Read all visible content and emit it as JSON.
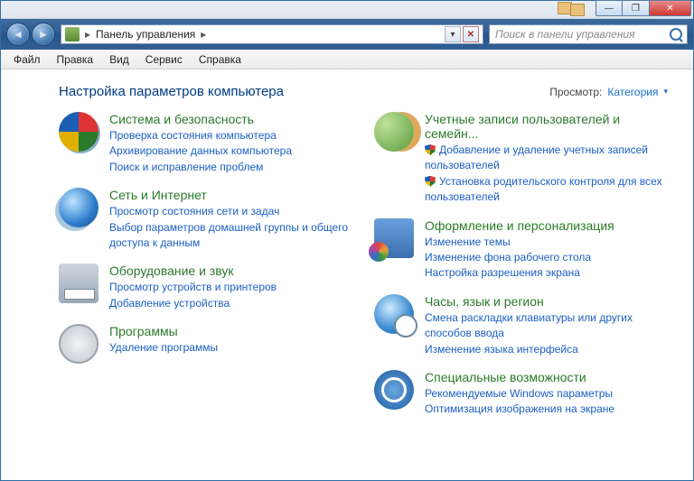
{
  "window": {
    "minimize": "—",
    "maximize": "❐",
    "close": "✕"
  },
  "nav": {
    "back": "◄",
    "forward": "►",
    "breadcrumb_sep1": "▸",
    "breadcrumb_label": "Панель управления",
    "breadcrumb_sep2": "▸",
    "dropdown": "▾",
    "stop": "✕"
  },
  "search": {
    "placeholder": "Поиск в панели управления"
  },
  "menu": {
    "file": "Файл",
    "edit": "Правка",
    "view": "Вид",
    "tools": "Сервис",
    "help": "Справка"
  },
  "header": {
    "title": "Настройка параметров компьютера",
    "view_label": "Просмотр:",
    "view_value": "Категория",
    "view_caret": "▾"
  },
  "left": [
    {
      "icon": "ic-sys",
      "name": "system-security",
      "title": "Система и безопасность",
      "links": [
        {
          "label": "Проверка состояния компьютера",
          "shield": false
        },
        {
          "label": "Архивирование данных компьютера",
          "shield": false
        },
        {
          "label": "Поиск и исправление проблем",
          "shield": false
        }
      ]
    },
    {
      "icon": "ic-net",
      "name": "network-internet",
      "title": "Сеть и Интернет",
      "links": [
        {
          "label": "Просмотр состояния сети и задач",
          "shield": false
        },
        {
          "label": "Выбор параметров домашней группы и общего доступа к данным",
          "shield": false
        }
      ]
    },
    {
      "icon": "ic-hw",
      "name": "hardware-sound",
      "title": "Оборудование и звук",
      "links": [
        {
          "label": "Просмотр устройств и принтеров",
          "shield": false
        },
        {
          "label": "Добавление устройства",
          "shield": false
        }
      ]
    },
    {
      "icon": "ic-prg",
      "name": "programs",
      "title": "Программы",
      "links": [
        {
          "label": "Удаление программы",
          "shield": false
        }
      ]
    }
  ],
  "right": [
    {
      "icon": "ic-usr",
      "name": "user-accounts-family",
      "title": "Учетные записи пользователей и семейн...",
      "links": [
        {
          "label": "Добавление и удаление учетных записей пользователей",
          "shield": true
        },
        {
          "label": "Установка родительского контроля для всех пользователей",
          "shield": true
        }
      ]
    },
    {
      "icon": "ic-app",
      "name": "appearance-personalization",
      "title": "Оформление и персонализация",
      "links": [
        {
          "label": "Изменение темы",
          "shield": false
        },
        {
          "label": "Изменение фона рабочего стола",
          "shield": false
        },
        {
          "label": "Настройка разрешения экрана",
          "shield": false
        }
      ]
    },
    {
      "icon": "ic-clk",
      "name": "clock-language-region",
      "title": "Часы, язык и регион",
      "links": [
        {
          "label": "Смена раскладки клавиатуры или других способов ввода",
          "shield": false
        },
        {
          "label": "Изменение языка интерфейса",
          "shield": false
        }
      ]
    },
    {
      "icon": "ic-acc",
      "name": "ease-of-access",
      "title": "Специальные возможности",
      "links": [
        {
          "label": "Рекомендуемые Windows параметры",
          "shield": false
        },
        {
          "label": "Оптимизация изображения на экране",
          "shield": false
        }
      ]
    }
  ]
}
